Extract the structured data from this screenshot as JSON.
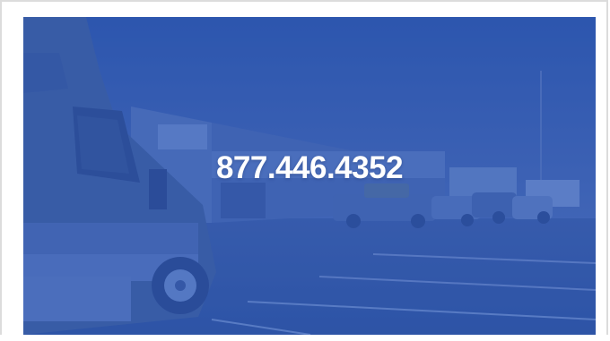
{
  "hero": {
    "phone_number": "877.446.4352",
    "overlay_color": "#2f57b3",
    "image_subject": "truck-fleet-photo"
  }
}
